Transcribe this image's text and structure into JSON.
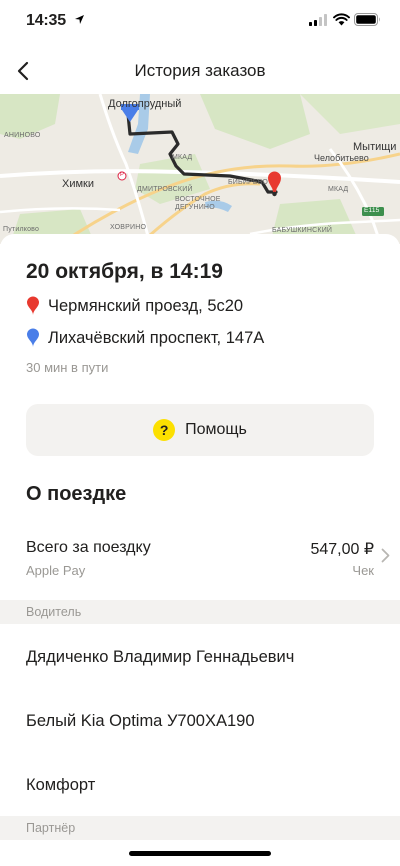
{
  "status_bar": {
    "time": "14:35"
  },
  "nav": {
    "title": "История заказов"
  },
  "map": {
    "labels": {
      "dolgoprudny": "Долгопрудный",
      "khimki": "Химки",
      "mytishchi": "Мытищи",
      "chelobityevo": "Челобитьево",
      "annino": "АНИНОВО",
      "dmitrovsky": "ДМИТРОВСКИЙ",
      "vostochnoe_1": "ВОСТОЧНОЕ",
      "vostochnoe_2": "ДЕГУНИНО",
      "khovrino": "ХОВРИНО",
      "bibirevo": "БИБИРЕВО",
      "mkad_1": "МКАД",
      "mkad_2": "МКАД",
      "putilkovo": "Путилково",
      "babushkinsky": "БАБУШКИНСКИЙ",
      "e115": "E115",
      "r_badge": "Р"
    }
  },
  "order": {
    "date": "20 октября, в 14:19",
    "from": "Чермянский проезд, 5с20",
    "to": "Лихачёвский проспект, 147А",
    "duration": "30 мин в пути"
  },
  "help": {
    "label": "Помощь",
    "icon_glyph": "?"
  },
  "trip": {
    "section_title": "О поездке",
    "total_label": "Всего за поездку",
    "payment_method": "Apple Pay",
    "amount": "547,00 ₽",
    "receipt_label": "Чек"
  },
  "driver": {
    "section_label": "Водитель",
    "name": "Дядиченко Владимир Геннадьевич",
    "car": "Белый Kia Optima У700ХА190",
    "tariff": "Комфорт"
  },
  "partner": {
    "section_label": "Партнёр"
  },
  "colors": {
    "pin_red": "#e8392f",
    "pin_blue": "#4a7ee8",
    "help_yellow": "#fce000",
    "route": "#2b2b2b"
  }
}
